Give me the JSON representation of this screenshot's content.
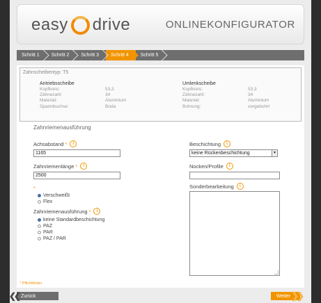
{
  "header": {
    "logo_left": "easy",
    "logo_right": "drive",
    "title": "ONLINEKONFIGURATOR"
  },
  "steps": [
    {
      "label": "Schritt 1",
      "active": false
    },
    {
      "label": "Schritt 2",
      "active": false
    },
    {
      "label": "Schritt 3",
      "active": false
    },
    {
      "label": "Schritt 4",
      "active": true
    },
    {
      "label": "Schritt 5",
      "active": false
    }
  ],
  "summary": {
    "type_label": "Zahnscheibentyp: T5",
    "left": {
      "heading": "Antriebsscheibe",
      "rows": [
        {
          "key": "Kopfkreis:",
          "value": "53,3"
        },
        {
          "key": "Zähnezahl:",
          "value": "34"
        },
        {
          "key": "Material:",
          "value": "Aluminium"
        },
        {
          "key": "Spannbuchse:",
          "value": "Boda"
        }
      ]
    },
    "right": {
      "heading": "Umlenkscheibe",
      "rows": [
        {
          "key": "Kopfkreis:",
          "value": "53,3"
        },
        {
          "key": "Zähnezahl:",
          "value": "34"
        },
        {
          "key": "Material:",
          "value": "Aluminium"
        },
        {
          "key": "Bohrung:",
          "value": "vorgebohrt"
        }
      ]
    }
  },
  "form": {
    "section_title": "Zahnriemenausführung",
    "achsabstand_label": "Achsabstand",
    "achsabstand_value": "1165",
    "laenge_label": "Zahnriemenlänge",
    "laenge_value": "2500",
    "required_mark": "*",
    "info_glyph": "i",
    "wear_options": [
      {
        "label": "Verschweißt",
        "selected": true
      },
      {
        "label": "Flex",
        "selected": false
      }
    ],
    "ausfuehrung_label": "Zahnriemenausführung",
    "ausfuehrung_options": [
      {
        "label": "keine Standardbeschichtung",
        "selected": true
      },
      {
        "label": "PAZ",
        "selected": false
      },
      {
        "label": "PAR",
        "selected": false
      },
      {
        "label": "PAZ / PAR",
        "selected": false
      }
    ],
    "beschichtung_label": "Beschichtung",
    "beschichtung_value": "keine Rückenbeschichtung",
    "nocken_label": "Nocken/Profile",
    "nocken_value": "",
    "sonder_label": "Sonderbearbeitung",
    "sonder_value": ""
  },
  "footer": {
    "required_note": "* Pflichtfelder",
    "back_label": "Zurück",
    "next_label": "Weiter"
  },
  "colors": {
    "accent": "#f29400",
    "stepbar": "#6e6e6e",
    "background": "#2d2d2d"
  }
}
